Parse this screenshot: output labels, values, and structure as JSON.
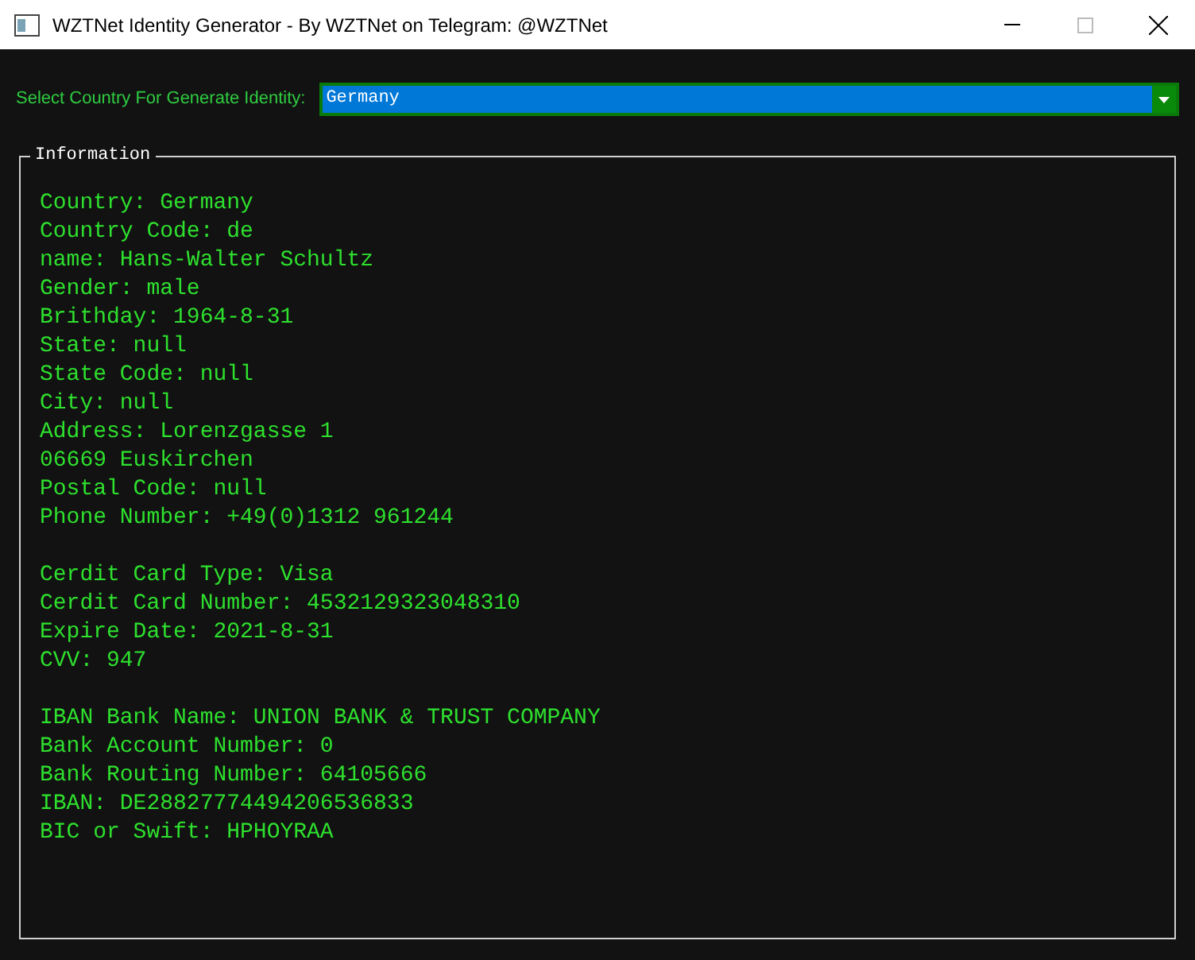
{
  "window": {
    "title": "WZTNet Identity Generator - By WZTNet on Telegram: @WZTNet"
  },
  "country_select": {
    "label": "Select Country For Generate Identity:",
    "value": "Germany"
  },
  "information": {
    "title": "Information",
    "groups": [
      [
        "Country: Germany",
        "Country Code: de",
        "name: Hans-Walter Schultz",
        "Gender: male",
        "Brithday: 1964-8-31",
        "State: null",
        "State Code: null",
        "City: null",
        "Address: Lorenzgasse 1",
        "06669 Euskirchen",
        "Postal Code: null",
        "Phone Number: +49(0)1312 961244"
      ],
      [
        "Cerdit Card Type: Visa",
        "Cerdit Card Number: 4532129323048310",
        "Expire Date: 2021-8-31",
        "CVV: 947"
      ],
      [
        "IBAN Bank Name: UNION BANK & TRUST COMPANY",
        "Bank Account Number: 0",
        "Bank Routing Number: 64105666",
        "IBAN: DE28827774494206536833",
        "BIC or Swift: HPHOYRAA"
      ]
    ]
  }
}
